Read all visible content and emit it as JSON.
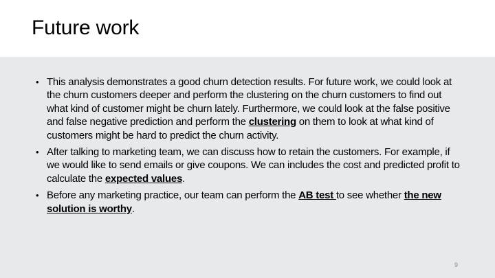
{
  "slide": {
    "title": "Future work",
    "page_number": "9"
  },
  "bullets": [
    {
      "part1": "This analysis demonstrates a good churn detection results. For future work, we could look at the churn customers deeper and perform the clustering on the churn customers to find out what kind of customer might be churn lately. Furthermore, we could look at the false positive and false negative prediction and perform the ",
      "emph1": "clustering",
      "part2": " on them to look at what kind of customers might be hard to predict the churn activity."
    },
    {
      "part1": "After talking to marketing team, we can discuss how to retain the customers. For example, if we would like to send emails or give coupons. We can includes the cost and predicted profit to calculate the ",
      "emph1": "expected values",
      "part2": "."
    },
    {
      "part1": "Before any marketing practice, our team can perform the ",
      "emph1": "AB test ",
      "part2": "to see whether ",
      "emph2": "the new solution is worthy",
      "part3": "."
    }
  ],
  "bullet_glyph": "•"
}
